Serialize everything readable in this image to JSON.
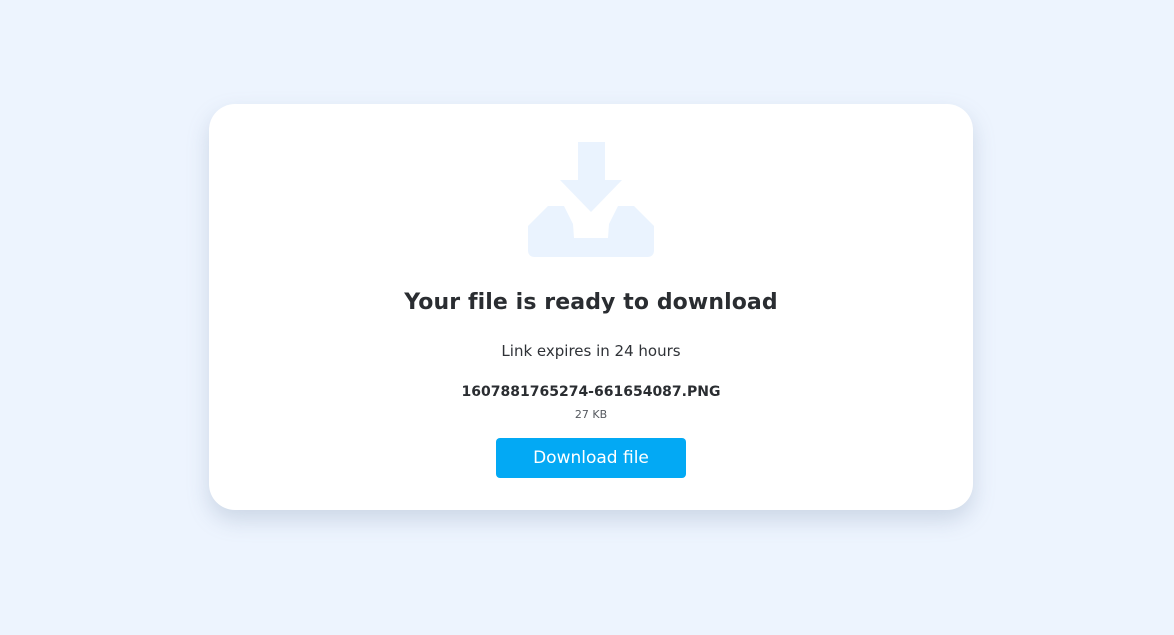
{
  "card": {
    "title": "Your file is ready to download",
    "subtitle": "Link expires in 24 hours",
    "icon": "download-tray-icon",
    "file": {
      "name": "1607881765274-661654087.PNG",
      "size": "27 KB"
    },
    "download_label": "Download file"
  },
  "colors": {
    "background": "#edf4fe",
    "card": "#ffffff",
    "icon": "#eaf3fe",
    "button": "#03a9f4",
    "button_text": "#ffffff",
    "text": "#2a2d31"
  }
}
